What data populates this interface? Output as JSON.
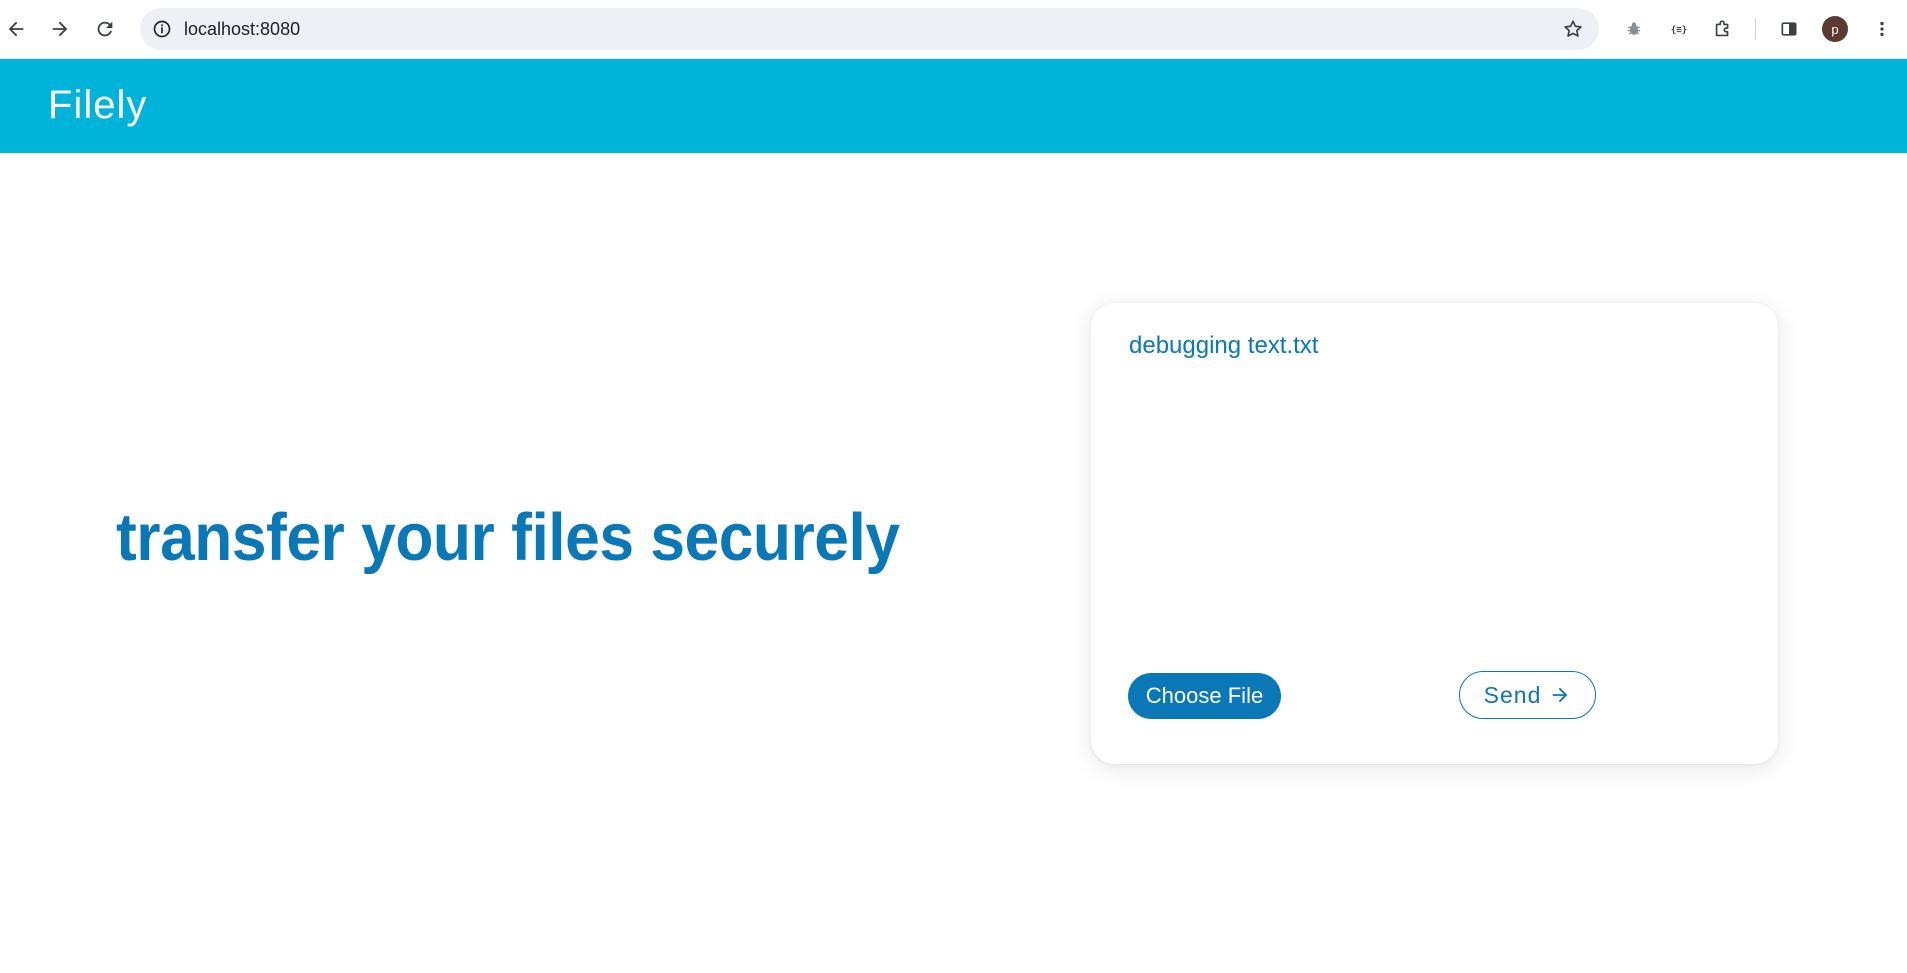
{
  "browser": {
    "url": "localhost:8080",
    "profile_initial": "p",
    "icons": [
      "back-arrow-icon",
      "forward-arrow-icon",
      "reload-icon",
      "site-info-icon",
      "bookmark-star-icon",
      "bug-extension-icon",
      "json-extension-icon",
      "puzzle-extensions-icon",
      "side-panel-icon",
      "kebab-menu-icon"
    ]
  },
  "app": {
    "title": "Filely"
  },
  "hero": {
    "headline": "transfer your files securely"
  },
  "upload_card": {
    "selected_file": "debugging text.txt",
    "choose_file_label": "Choose File",
    "send_label": "Send",
    "send_icon": "arrow-right-icon"
  },
  "colors": {
    "header_bg": "#00b3d8",
    "primary": "#0a77b6",
    "omnibox_bg": "#eef0f6",
    "avatar_bg": "#5b3a31"
  }
}
